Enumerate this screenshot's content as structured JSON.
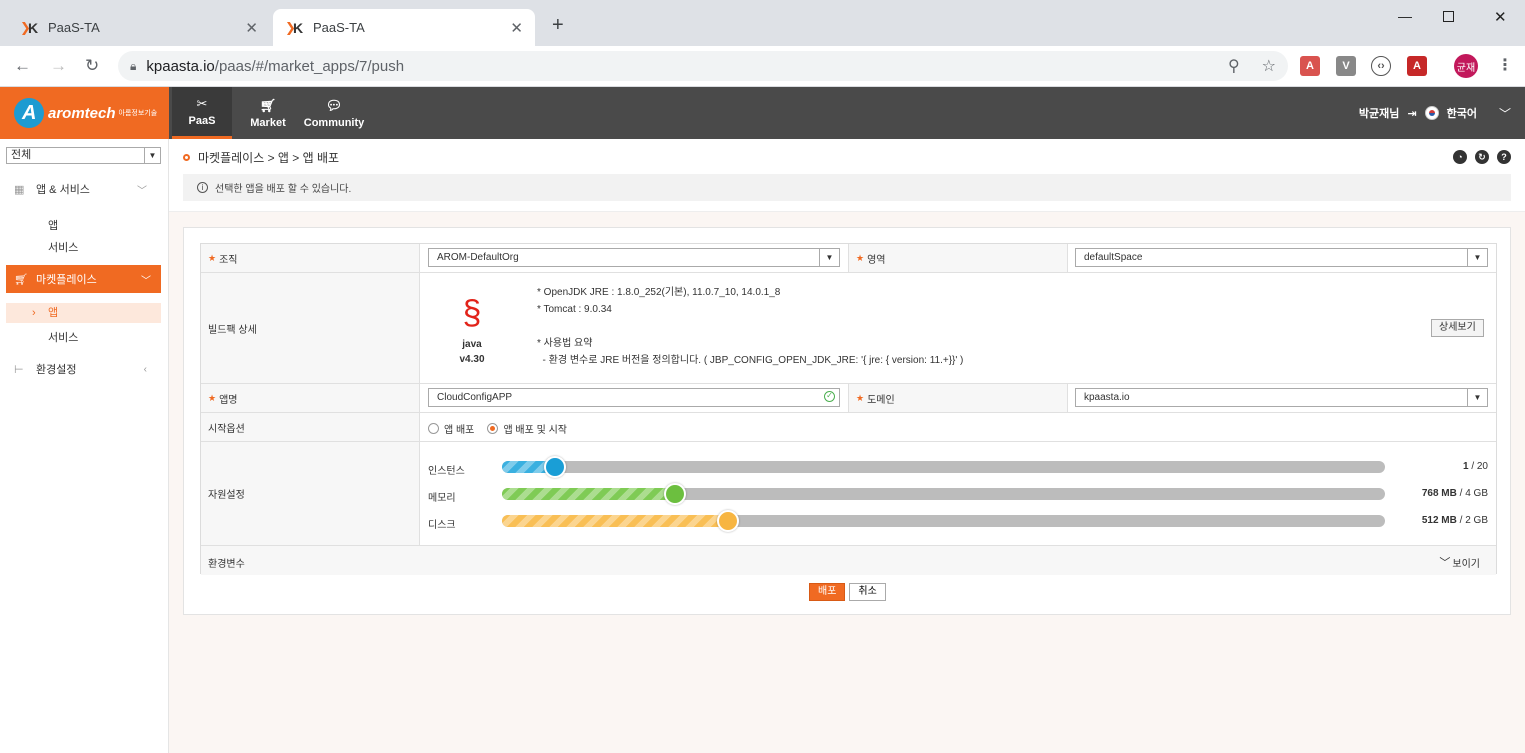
{
  "browser": {
    "tabs": [
      {
        "title": "PaaS-TA",
        "active": false
      },
      {
        "title": "PaaS-TA",
        "active": true
      }
    ],
    "url_host": "kpaasta.io",
    "url_path": "/paas/#/market_apps/7/push",
    "profile_initials": "균재"
  },
  "header": {
    "brand": "aromtech",
    "brand_sub": "아롬정보기술",
    "nav": [
      {
        "label": "PaaS",
        "icon": "tools-icon",
        "active": true
      },
      {
        "label": "Market",
        "icon": "cart-icon",
        "active": false
      },
      {
        "label": "Community",
        "icon": "chat-icon",
        "active": false
      }
    ],
    "user": "박균재님",
    "language": "한국어"
  },
  "sidebar": {
    "filter_value": "전체",
    "groups": [
      {
        "label": "앱 & 서비스",
        "items": [
          "앱",
          "서비스"
        ]
      },
      {
        "label": "마켓플레이스",
        "items": [
          "앱",
          "서비스"
        ],
        "active": true
      },
      {
        "label": "환경설정",
        "items": []
      }
    ]
  },
  "page": {
    "breadcrumb": "마켓플레이스 > 앱 > 앱 배포",
    "notice": "선택한 앱을 배포 할 수 있습니다."
  },
  "form": {
    "org_label": "조직",
    "org_value": "AROM-DefaultOrg",
    "space_label": "영역",
    "space_value": "defaultSpace",
    "buildpack_label": "빌드팩 상세",
    "buildpack_name": "java",
    "buildpack_version": "v4.30",
    "buildpack_desc": [
      "* OpenJDK JRE : 1.8.0_252(기본), 11.0.7_10, 14.0.1_8",
      "* Tomcat : 9.0.34",
      "",
      "* 사용법 요약",
      "  - 환경 변수로 JRE 버전을 정의합니다. ( JBP_CONFIG_OPEN_JDK_JRE: '{ jre: { version: 11.+}}' )"
    ],
    "detail_button": "상세보기",
    "appname_label": "앱명",
    "appname_value": "CloudConfigAPP",
    "domain_label": "도메인",
    "domain_value": "kpaasta.io",
    "start_label": "시작옵션",
    "start_options": [
      "앱 배포",
      "앱 배포 및 시작"
    ],
    "start_selected": 1,
    "resource_label": "자원설정",
    "resources": [
      {
        "label": "인스턴스",
        "value": "1",
        "max": "/ 20",
        "fraction": 0.06,
        "color": "#1a9ed6",
        "fill": "#3ab0e0"
      },
      {
        "label": "메모리",
        "value": "768 MB",
        "max": "/ 4 GB",
        "fraction": 0.196,
        "color": "#6cbf3f",
        "fill": "#7fcb55"
      },
      {
        "label": "디스크",
        "value": "512 MB",
        "max": "/ 2 GB",
        "fraction": 0.256,
        "color": "#f7b541",
        "fill": "#f9bf55"
      }
    ],
    "env_label": "환경변수",
    "env_toggle": "보이기"
  },
  "actions": {
    "deploy": "배포",
    "cancel": "취소"
  }
}
